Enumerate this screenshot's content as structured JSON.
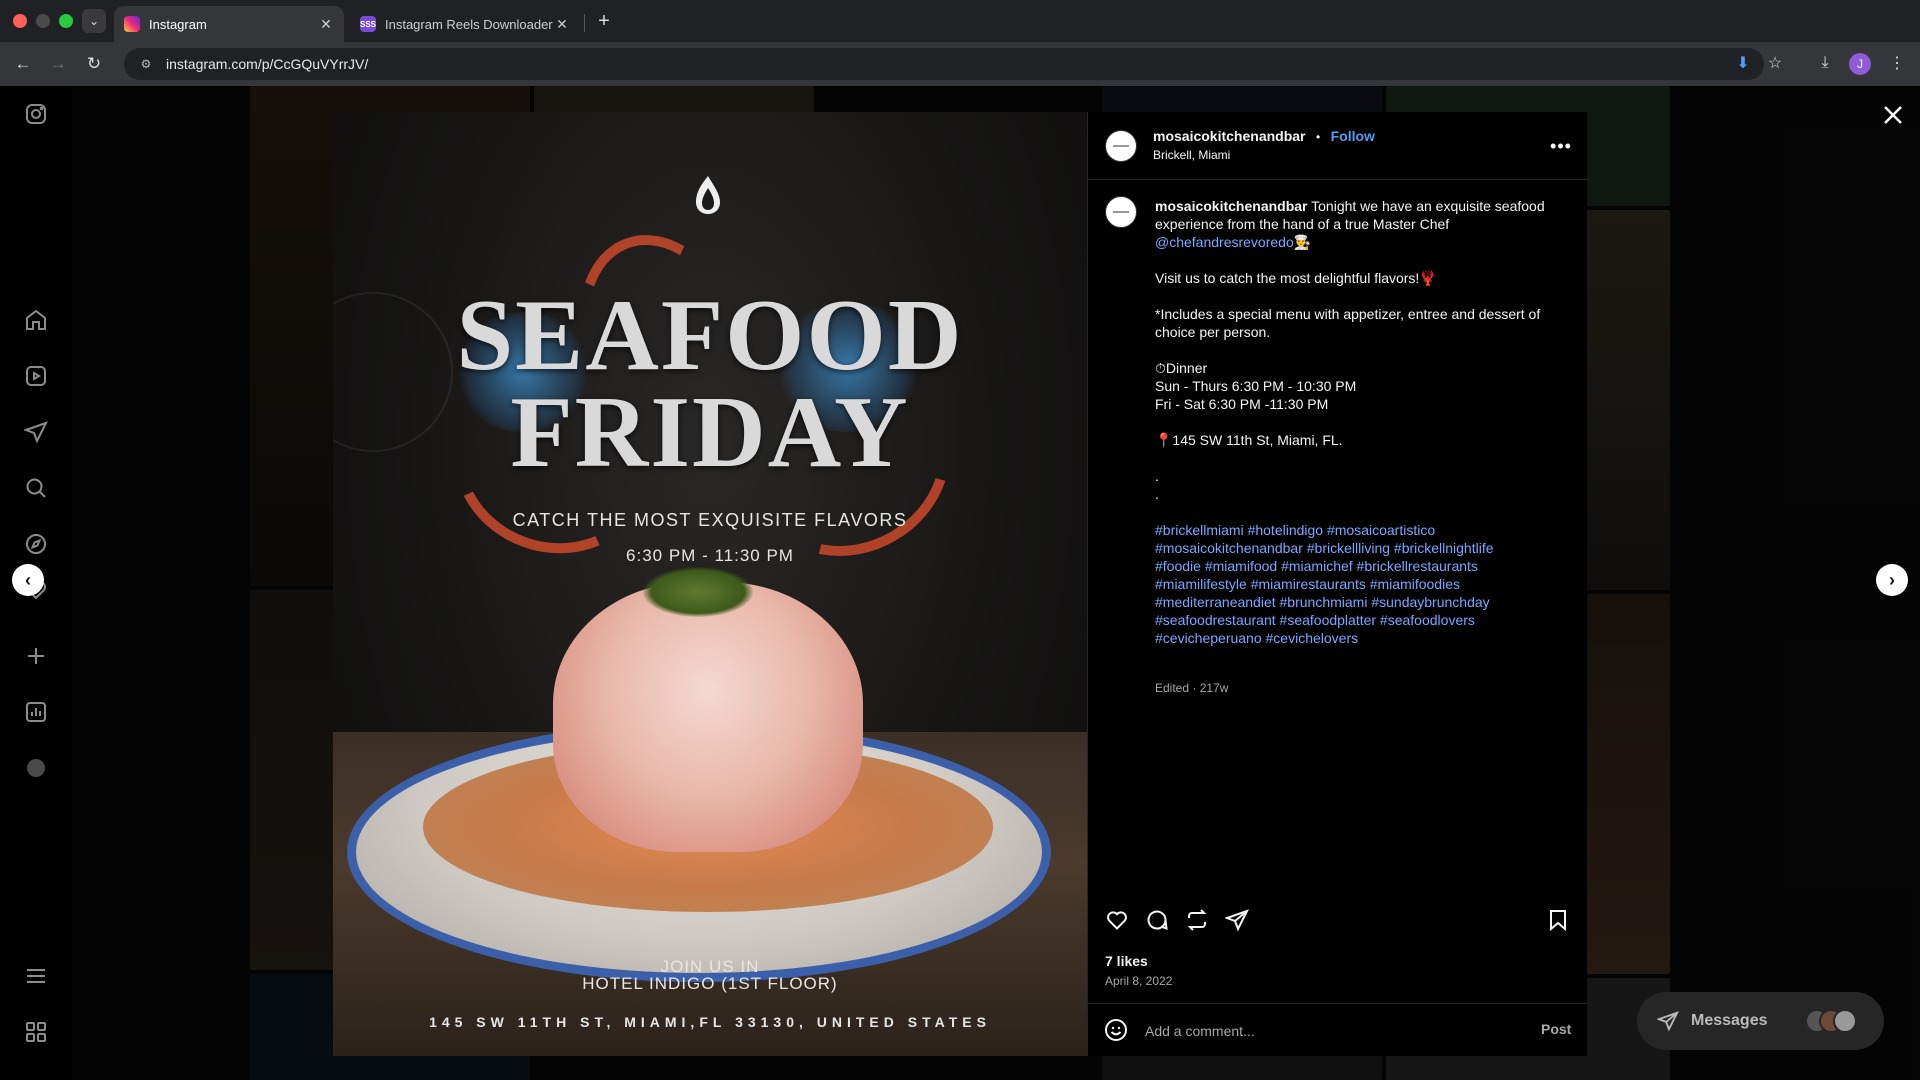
{
  "browser": {
    "tabs": [
      {
        "title": "Instagram",
        "active": true
      },
      {
        "title": "Instagram Reels Downloader",
        "active": false
      }
    ],
    "favicon_text_downloader": "SSS",
    "url": "instagram.com/p/CcGQuVYrrJV/",
    "profile_initial": "J"
  },
  "post": {
    "image": {
      "headline_line1": "SEAFOOD",
      "headline_line2": "FRIDAY",
      "tagline": "CATCH THE MOST EXQUISITE FLAVORS",
      "hours": "6:30 PM - 11:30 PM",
      "join_line1": "JOIN US IN",
      "join_line2": "HOTEL INDIGO (1ST FLOOR)",
      "address": "145 SW 11TH ST, MIAMI,FL 33130, UNITED STATES"
    },
    "header": {
      "username": "mosaicokitchenandbar",
      "separator": "•",
      "follow_label": "Follow",
      "location": "Brickell, Miami"
    },
    "caption": {
      "username": "mosaicokitchenandbar",
      "intro": " Tonight we have an exquisite seafood experience from the hand of a true Master Chef ",
      "mention": "@chefandresrevoredo",
      "mention_emoji": "👨‍🍳",
      "line_visit": "Visit us to catch the most delightful flavors!🦞",
      "line_includes": "*Includes a special menu with appetizer, entree and dessert of choice per person.",
      "line_dinner": "⏱Dinner",
      "line_sun": "Sun - Thurs 6:30 PM - 10:30 PM",
      "line_fri": "Fri - Sat 6:30 PM -11:30 PM",
      "line_address": "📍145 SW 11th St, Miami, FL.",
      "dot1": ".",
      "dot2": ".",
      "hashtags_line1": "#brickellmiami #hotelindigo #mosaicoartistico",
      "hashtags_line2": "#mosaicokitchenandbar #brickellliving #brickellnightlife",
      "hashtags_line3": "#foodie #miamifood #miamichef #brickellrestaurants",
      "hashtags_line4": "#miamilifestyle #miamirestaurants #miamifoodies",
      "hashtags_line5": "#mediterraneandiet #brunchmiami #sundaybrunchday",
      "hashtags_line6": "#seafoodrestaurant #seafoodplatter #seafoodlovers",
      "hashtags_line7": "#cevicheperuano #cevichelovers",
      "edited": "Edited · 217w"
    },
    "likes": "7 likes",
    "date": "April 8, 2022",
    "comment_placeholder": "Add a comment...",
    "post_label": "Post"
  },
  "messages": {
    "label": "Messages"
  },
  "icons": {
    "nav": [
      "instagram-icon",
      "home-icon",
      "reels-icon",
      "send-icon",
      "search-icon",
      "explore-icon",
      "heart-icon",
      "create-icon",
      "dashboard-icon",
      "profile-icon",
      "menu-icon",
      "also-from-meta-icon"
    ],
    "actions": [
      "like-icon",
      "comment-icon",
      "repost-icon",
      "share-icon",
      "save-icon"
    ]
  }
}
